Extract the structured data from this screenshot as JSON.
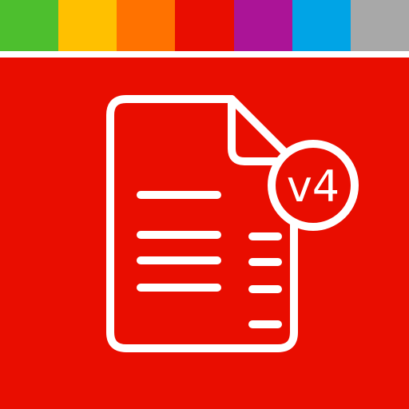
{
  "colors": {
    "panel": "#e90d00",
    "line": "#ffffff",
    "strip": [
      "#4dbf2e",
      "#ffc000",
      "#ff7200",
      "#e90d00",
      "#ab1497",
      "#00a4e6",
      "#a8a8a8"
    ]
  },
  "icon": {
    "name": "document-icon",
    "badge_text": "v4"
  }
}
